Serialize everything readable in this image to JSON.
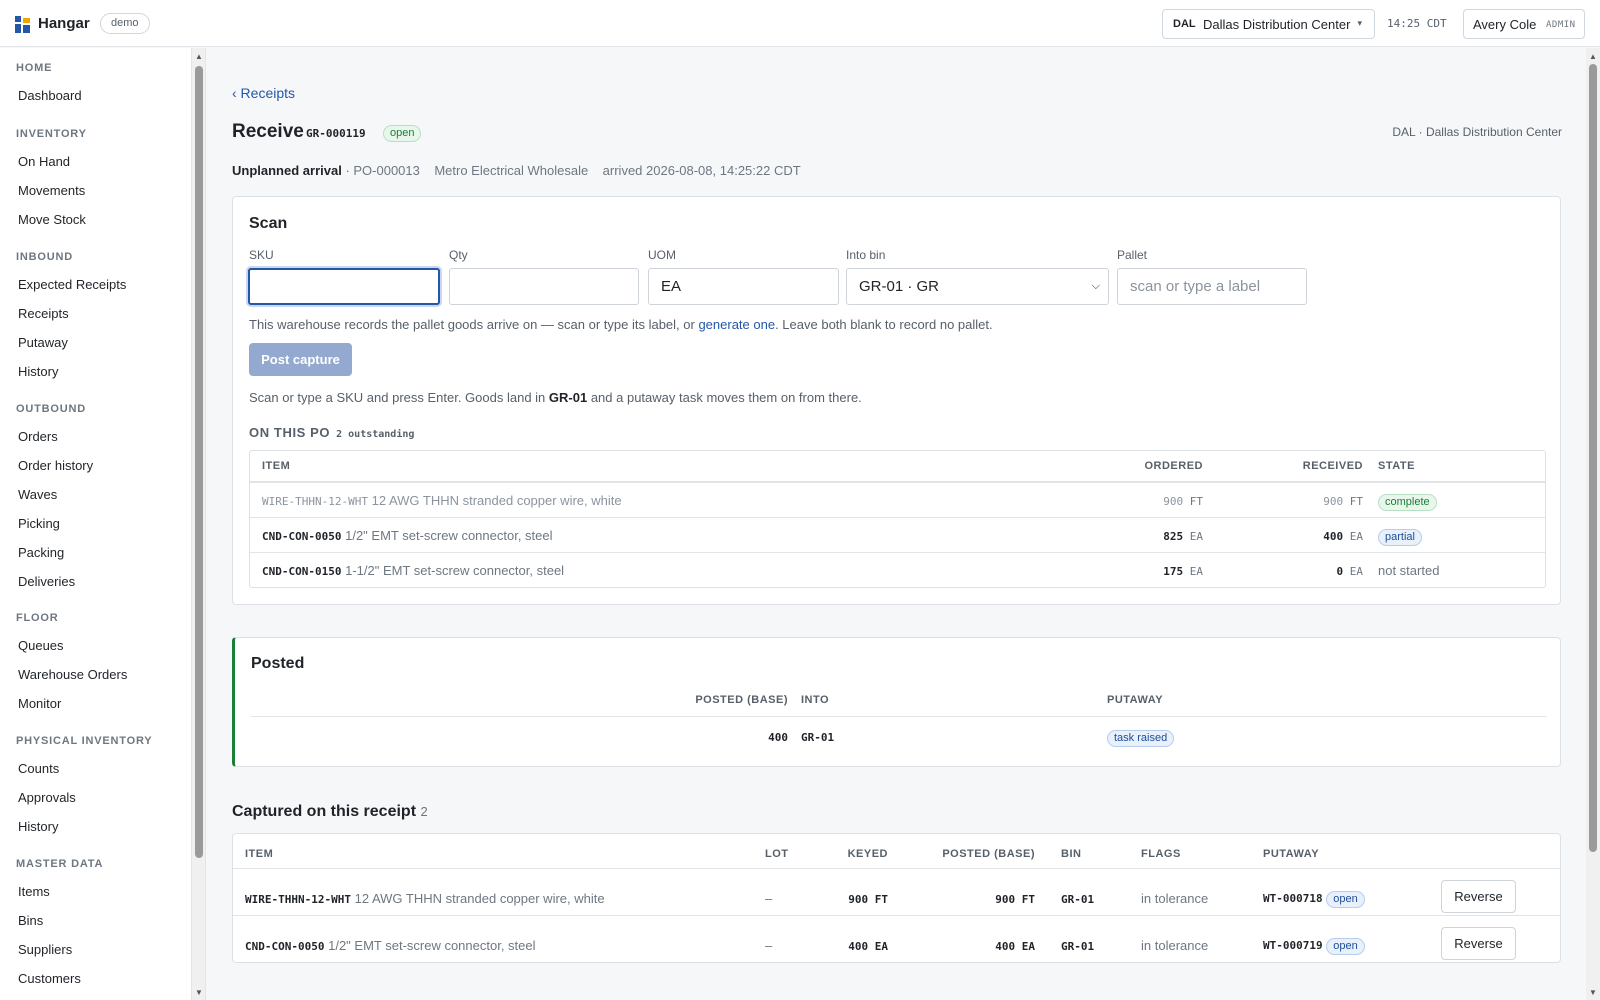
{
  "app": {
    "name": "Hangar",
    "env_badge": "demo"
  },
  "header": {
    "site_code": "DAL",
    "site_name": "Dallas Distribution Center",
    "site_caret": "▾",
    "clock": "14:25 CDT",
    "user_name": "Avery Cole",
    "user_role": "ADMIN"
  },
  "sidebar": {
    "sections": [
      {
        "label": "HOME",
        "items": [
          "Dashboard"
        ]
      },
      {
        "label": "INVENTORY",
        "items": [
          "On Hand",
          "Movements",
          "Move Stock"
        ]
      },
      {
        "label": "INBOUND",
        "items": [
          "Expected Receipts",
          "Receipts",
          "Putaway",
          "History"
        ]
      },
      {
        "label": "OUTBOUND",
        "items": [
          "Orders",
          "Order history",
          "Waves",
          "Picking",
          "Packing",
          "Deliveries"
        ]
      },
      {
        "label": "FLOOR",
        "items": [
          "Queues",
          "Warehouse Orders",
          "Monitor"
        ]
      },
      {
        "label": "PHYSICAL INVENTORY",
        "items": [
          "Counts",
          "Approvals",
          "History"
        ]
      },
      {
        "label": "MASTER DATA",
        "items": [
          "Items",
          "Bins",
          "Suppliers",
          "Customers"
        ]
      }
    ]
  },
  "page": {
    "back_link": "‹ Receipts",
    "title": "Receive",
    "doc_no": "GR-000119",
    "status": "open",
    "site_label": "DAL · Dallas Distribution Center",
    "arrival_kind": "Unplanned arrival",
    "po_ref": "· PO-000013",
    "supplier": "Metro Electrical Wholesale",
    "arrived": "arrived 2026-08-08, 14:25:22 CDT"
  },
  "scan": {
    "title": "Scan",
    "sku_label": "SKU",
    "sku_value": "",
    "qty_label": "Qty",
    "qty_value": "",
    "uom_label": "UOM",
    "uom_value": "EA",
    "bin_label": "Into bin",
    "bin_value": "GR-01 · GR",
    "pallet_label": "Pallet",
    "pallet_placeholder": "scan or type a label",
    "help_before": "This warehouse records the pallet goods arrive on — scan or type its label, or ",
    "help_link": "generate one",
    "help_after": ". Leave both blank to record no pallet.",
    "post_button": "Post capture",
    "note_before": "Scan or type a SKU and press Enter. Goods land in ",
    "note_bin": "GR-01",
    "note_after": " and a putaway task moves them on from there."
  },
  "po_lines": {
    "heading": "ON THIS PO",
    "outstanding": "2 outstanding",
    "columns": {
      "item": "ITEM",
      "ordered": "ORDERED",
      "received": "RECEIVED",
      "state": "STATE"
    },
    "rows": [
      {
        "sku": "WIRE-THHN-12-WHT",
        "desc": "12 AWG THHN stranded copper wire, white",
        "ordered": "900",
        "ordered_uom": "FT",
        "received": "900",
        "received_uom": "FT",
        "state": "complete"
      },
      {
        "sku": "CND-CON-0050",
        "desc": "1/2\" EMT set-screw connector, steel",
        "ordered": "825",
        "ordered_uom": "EA",
        "received": "400",
        "received_uom": "EA",
        "state": "partial"
      },
      {
        "sku": "CND-CON-0150",
        "desc": "1-1/2\" EMT set-screw connector, steel",
        "ordered": "175",
        "ordered_uom": "EA",
        "received": "0",
        "received_uom": "EA",
        "state": "not started"
      }
    ]
  },
  "posted": {
    "title": "Posted",
    "columns": {
      "posted": "POSTED (BASE)",
      "into": "INTO",
      "putaway": "PUTAWAY"
    },
    "row": {
      "posted": "400",
      "into": "GR-01",
      "putaway": "task raised"
    }
  },
  "captured": {
    "title": "Captured on this receipt",
    "count": "2",
    "columns": {
      "item": "ITEM",
      "lot": "LOT",
      "keyed": "KEYED",
      "posted": "POSTED (BASE)",
      "bin": "BIN",
      "flags": "FLAGS",
      "putaway": "PUTAWAY"
    },
    "rows": [
      {
        "sku": "WIRE-THHN-12-WHT",
        "desc": "12 AWG THHN stranded copper wire, white",
        "lot": "–",
        "keyed": "900 FT",
        "posted": "900 FT",
        "bin": "GR-01",
        "flags": "in tolerance",
        "task": "WT-000718",
        "task_status": "open",
        "action": "Reverse"
      },
      {
        "sku": "CND-CON-0050",
        "desc": "1/2\" EMT set-screw connector, steel",
        "lot": "–",
        "keyed": "400 EA",
        "posted": "400 EA",
        "bin": "GR-01",
        "flags": "in tolerance",
        "task": "WT-000719",
        "task_status": "open",
        "action": "Reverse"
      }
    ]
  },
  "colors": {
    "accent": "#2557a7",
    "success": "#1a7f37",
    "disabled_button": "#93a9cf"
  }
}
